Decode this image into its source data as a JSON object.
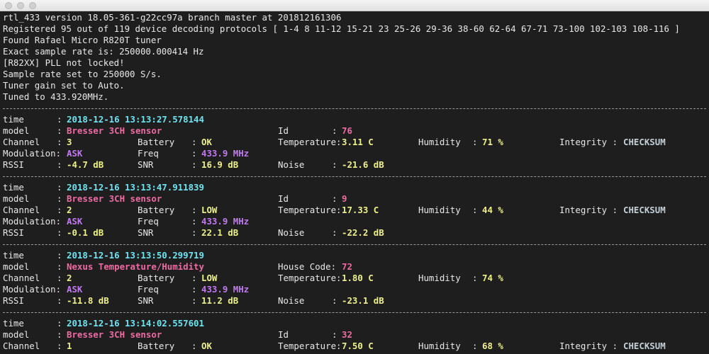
{
  "header_lines": [
    "rtl_433 version 18.05-361-g22cc97a branch master at 201812161306",
    "Registered 95 out of 119 device decoding protocols [ 1-4 8 11-12 15-21 23 25-26 29-36 38-60 62-64 67-71 73-100 102-103 108-116 ]",
    "Found Rafael Micro R820T tuner",
    "Exact sample rate is: 250000.000414 Hz",
    "[R82XX] PLL not locked!",
    "Sample rate set to 250000 S/s.",
    "Tuner gain set to Auto.",
    "Tuned to 433.920MHz."
  ],
  "labels": {
    "time": "time",
    "model": "model",
    "channel": "Channel",
    "modulation": "Modulation:",
    "rssi": "RSSI",
    "battery": "Battery",
    "freq": "Freq",
    "snr": "SNR",
    "id": "Id",
    "house_code": "House Code:",
    "temperature": "Temperature:",
    "noise": "Noise",
    "humidity": "Humidity",
    "integrity": "Integrity :",
    "colon": ":"
  },
  "records": [
    {
      "time": "2018-12-16 13:13:27.578144",
      "model": "Bresser 3CH sensor",
      "id": "76",
      "channel": "3",
      "battery": "OK",
      "temperature": "3.11 C",
      "humidity": "71 %",
      "integrity": "CHECKSUM",
      "modulation": "ASK",
      "freq": "433.9 MHz",
      "rssi": "-4.7 dB",
      "snr": "16.9 dB",
      "noise": "-21.6 dB"
    },
    {
      "time": "2018-12-16 13:13:47.911839",
      "model": "Bresser 3CH sensor",
      "id": "9",
      "channel": "2",
      "battery": "LOW",
      "temperature": "17.33 C",
      "humidity": "44 %",
      "integrity": "CHECKSUM",
      "modulation": "ASK",
      "freq": "433.9 MHz",
      "rssi": "-0.1 dB",
      "snr": "22.1 dB",
      "noise": "-22.2 dB"
    },
    {
      "time": "2018-12-16 13:13:50.299719",
      "model": "Nexus Temperature/Humidity",
      "house_code": "72",
      "channel": "2",
      "battery": "LOW",
      "temperature": "1.80 C",
      "humidity": "74 %",
      "modulation": "ASK",
      "freq": "433.9 MHz",
      "rssi": "-11.8 dB",
      "snr": "11.2 dB",
      "noise": "-23.1 dB"
    },
    {
      "time": "2018-12-16 13:14:02.557601",
      "model": "Bresser 3CH sensor",
      "id": "32",
      "channel": "1",
      "battery": "OK",
      "temperature": "7.50 C",
      "humidity": "68 %",
      "integrity": "CHECKSUM"
    }
  ],
  "colors": {
    "background": "#1e1e1e",
    "text": "#e8e8e8",
    "time": "#6fe3f0",
    "model": "#f06aa3",
    "value": "#eef08a",
    "modulation": "#c07af0",
    "integrity": "#c4cfd6"
  }
}
